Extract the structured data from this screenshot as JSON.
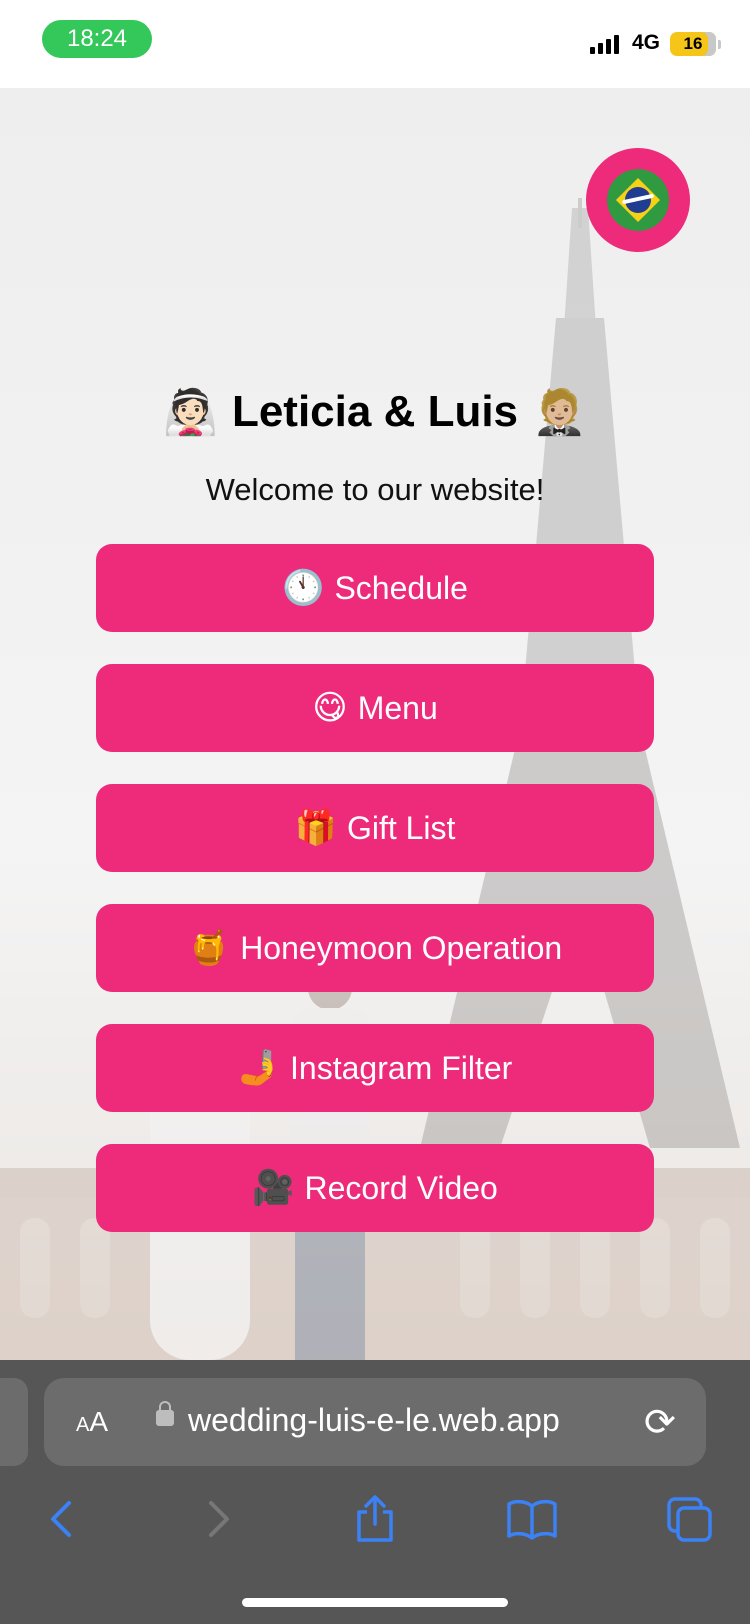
{
  "status_bar": {
    "time": "18:24",
    "network": "4G",
    "battery": "16"
  },
  "page": {
    "title_left_emoji": "👰🏻",
    "title": "Leticia & Luis",
    "title_right_emoji": "🤵🏼",
    "welcome": "Welcome to our website!",
    "language_button_icon": "brazil-flag-icon",
    "accent_color": "#ee2a7b",
    "buttons": [
      {
        "emoji": "🕚",
        "label": "Schedule"
      },
      {
        "emoji": "😋",
        "label": "Menu"
      },
      {
        "emoji": "🎁",
        "label": "Gift List"
      },
      {
        "emoji": "🍯",
        "label": "Honeymoon Operation"
      },
      {
        "emoji": "🤳",
        "label": "Instagram Filter"
      },
      {
        "emoji": "🎥",
        "label": "Record Video"
      }
    ]
  },
  "browser": {
    "aa_label_small": "A",
    "aa_label_large": "A",
    "url": "wedding-luis-e-le.web.app",
    "reload_icon": "⟳",
    "toolbar_icons": [
      "back-icon",
      "forward-icon",
      "share-icon",
      "bookmarks-icon",
      "tabs-icon"
    ],
    "link_color": "#3b82f6"
  }
}
